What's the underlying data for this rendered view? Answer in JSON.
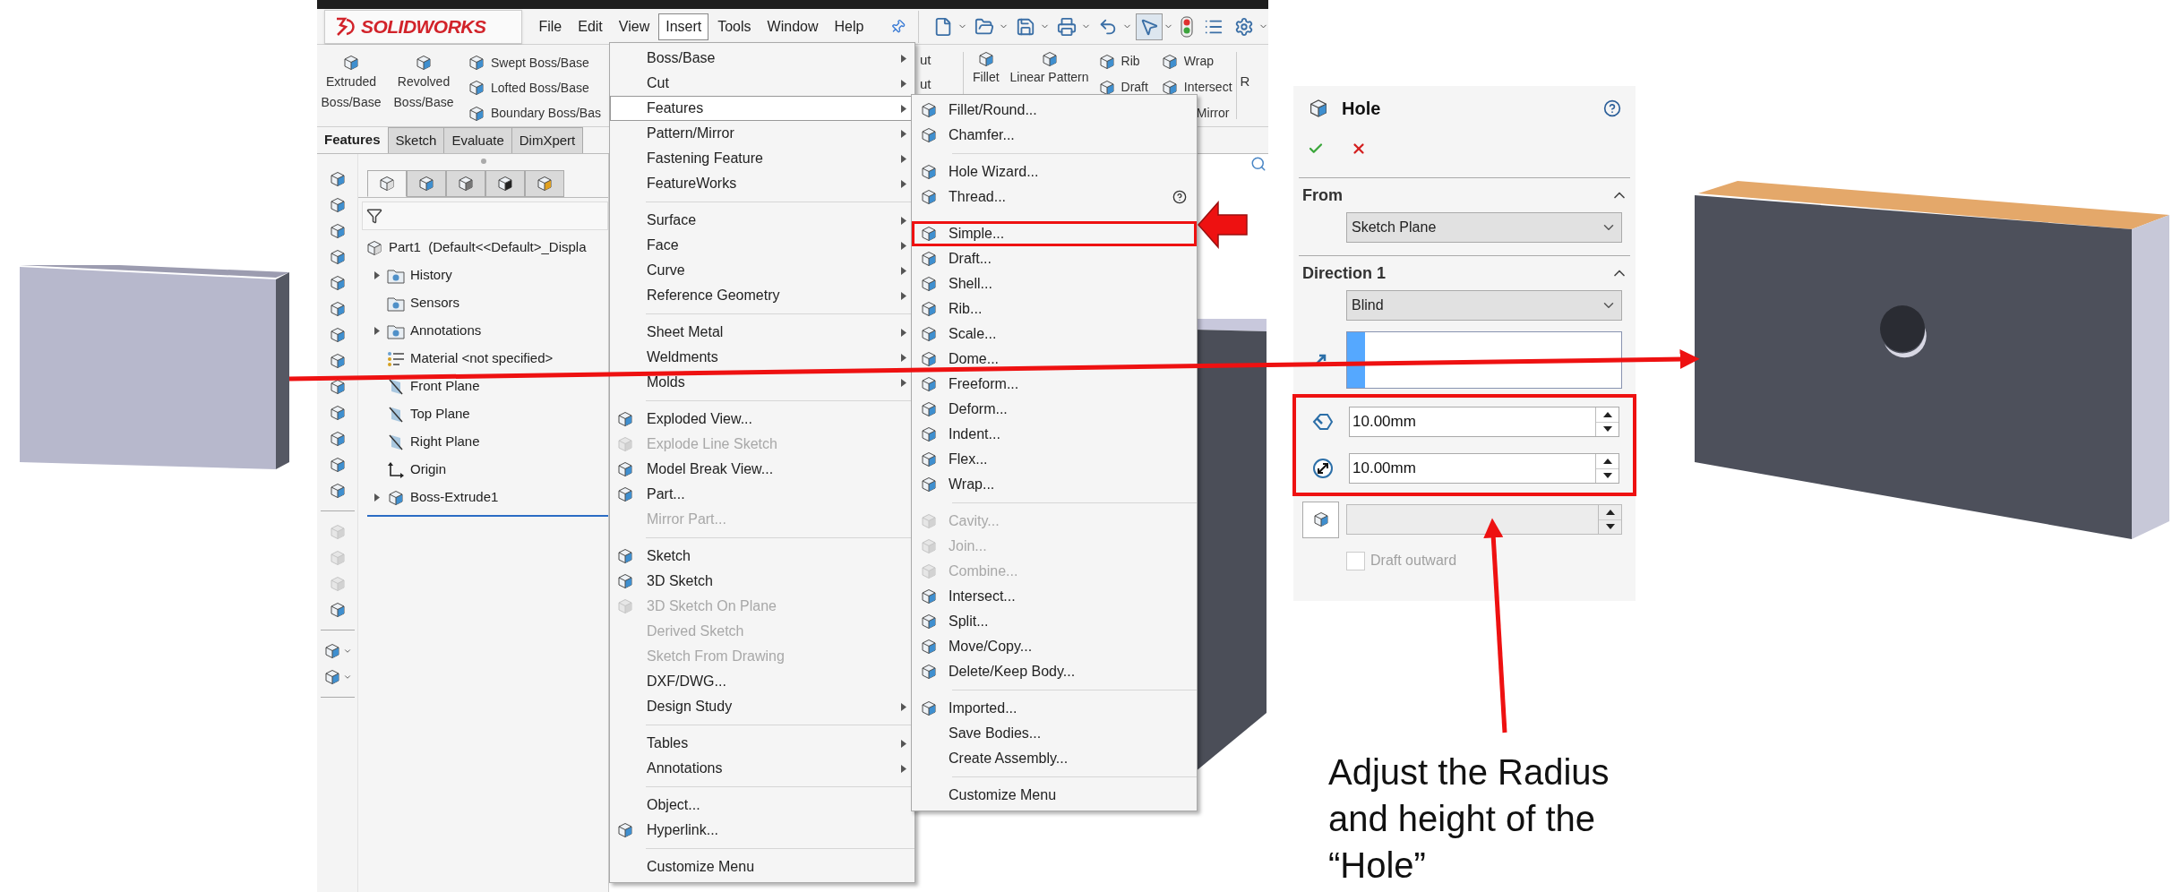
{
  "window": {
    "logo": "SOLIDWORKS",
    "menu_bar": [
      {
        "label": "File",
        "selected": false
      },
      {
        "label": "Edit",
        "selected": false
      },
      {
        "label": "View",
        "selected": false
      },
      {
        "label": "Insert",
        "selected": true
      },
      {
        "label": "Tools",
        "selected": false
      },
      {
        "label": "Window",
        "selected": false
      },
      {
        "label": "Help",
        "selected": false
      }
    ],
    "quick_access": [
      {
        "selected": false
      },
      {
        "selected": false
      },
      {
        "selected": false
      },
      {
        "selected": false
      },
      {
        "selected": false
      },
      {
        "selected": true
      },
      {
        "selected": false
      },
      {
        "selected": false
      },
      {
        "selected": false
      }
    ],
    "ribbon": {
      "large": [
        "Extruded Boss/Base",
        "Revolved Boss/Base"
      ],
      "small": [
        "Swept Boss/Base",
        "Lofted Boss/Base",
        "Boundary Boss/Bas"
      ],
      "fragments": [
        "ut",
        "ut"
      ],
      "features_large": [
        "Fillet",
        "Linear Pattern"
      ],
      "features_small_1": [
        "Rib",
        "Draft"
      ],
      "features_small_2": [
        "Wrap",
        "Intersect",
        "Mirror"
      ],
      "cut_label": "R"
    },
    "tabs": [
      {
        "label": "Features",
        "selected": true
      },
      {
        "label": "Sketch",
        "selected": false
      },
      {
        "label": "Evaluate",
        "selected": false
      },
      {
        "label": "DimXpert",
        "selected": false
      }
    ],
    "command_tools": [
      [
        {
          "kind": "button",
          "disabled": false
        },
        {
          "kind": "button",
          "disabled": false
        },
        {
          "kind": "button",
          "disabled": false
        },
        {
          "kind": "button",
          "disabled": false
        },
        {
          "kind": "button",
          "disabled": false
        },
        {
          "kind": "button",
          "disabled": false
        },
        {
          "kind": "button",
          "disabled": false
        },
        {
          "kind": "button",
          "disabled": false
        },
        {
          "kind": "button",
          "disabled": false
        },
        {
          "kind": "button",
          "disabled": false
        },
        {
          "kind": "button",
          "disabled": false
        },
        {
          "kind": "button",
          "disabled": false
        },
        {
          "kind": "button",
          "disabled": false
        }
      ],
      [
        {
          "kind": "button",
          "disabled": true
        },
        {
          "kind": "button",
          "disabled": true
        },
        {
          "kind": "button",
          "disabled": true
        },
        {
          "kind": "button",
          "disabled": false
        }
      ],
      [
        {
          "kind": "dropdown",
          "disabled": false
        },
        {
          "kind": "dropdown",
          "disabled": false
        }
      ]
    ],
    "panel_tabs": [
      {
        "selected": true
      },
      {
        "selected": false
      },
      {
        "selected": false
      },
      {
        "selected": false
      },
      {
        "selected": false
      }
    ],
    "tree": {
      "label": "Part1  (Default<<Default>_Displa",
      "children": [
        {
          "label": "History",
          "kind": "folder",
          "collapsible": true
        },
        {
          "label": "Sensors",
          "kind": "folder",
          "collapsible": false
        },
        {
          "label": "Annotations",
          "kind": "folder",
          "collapsible": true
        },
        {
          "label": "Material <not specified>",
          "kind": "material",
          "collapsible": false
        },
        {
          "label": "Front Plane",
          "kind": "plane",
          "collapsible": false
        },
        {
          "label": "Top Plane",
          "kind": "plane",
          "collapsible": false
        },
        {
          "label": "Right Plane",
          "kind": "plane",
          "collapsible": false
        },
        {
          "label": "Origin",
          "kind": "origin",
          "collapsible": false
        },
        {
          "label": "Boss-Extrude1",
          "kind": "body",
          "collapsible": true
        }
      ]
    }
  },
  "insert_menu": {
    "groups": [
      [
        {
          "label": "Boss/Base",
          "kind": "submenu",
          "selected": false,
          "disabled": false
        },
        {
          "label": "Cut",
          "kind": "submenu",
          "selected": false,
          "disabled": false
        },
        {
          "label": "Features",
          "kind": "submenu",
          "selected": true,
          "disabled": false
        },
        {
          "label": "Pattern/Mirror",
          "kind": "submenu",
          "selected": false,
          "disabled": false
        },
        {
          "label": "Fastening Feature",
          "kind": "submenu",
          "selected": false,
          "disabled": false
        },
        {
          "label": "FeatureWorks",
          "kind": "submenu",
          "selected": false,
          "disabled": false
        }
      ],
      [
        {
          "label": "Surface",
          "kind": "submenu",
          "selected": false,
          "disabled": false
        },
        {
          "label": "Face",
          "kind": "submenu",
          "selected": false,
          "disabled": false
        },
        {
          "label": "Curve",
          "kind": "submenu",
          "selected": false,
          "disabled": false
        },
        {
          "label": "Reference Geometry",
          "kind": "submenu",
          "selected": false,
          "disabled": false
        }
      ],
      [
        {
          "label": "Sheet Metal",
          "kind": "submenu",
          "selected": false,
          "disabled": false
        },
        {
          "label": "Weldments",
          "kind": "submenu",
          "selected": false,
          "disabled": false
        },
        {
          "label": "Molds",
          "kind": "submenu",
          "selected": false,
          "disabled": false
        }
      ],
      [
        {
          "label": "Exploded View...",
          "kind": "icon",
          "selected": false,
          "disabled": false
        },
        {
          "label": "Explode Line Sketch",
          "kind": "icon",
          "selected": false,
          "disabled": true
        },
        {
          "label": "Model Break View...",
          "kind": "icon",
          "selected": false,
          "disabled": false
        },
        {
          "label": "Part...",
          "kind": "icon",
          "selected": false,
          "disabled": false
        },
        {
          "label": "Mirror Part...",
          "kind": "plain",
          "selected": false,
          "disabled": true
        }
      ],
      [
        {
          "label": "Sketch",
          "kind": "icon",
          "selected": false,
          "disabled": false
        },
        {
          "label": "3D Sketch",
          "kind": "icon",
          "selected": false,
          "disabled": false
        },
        {
          "label": "3D Sketch On Plane",
          "kind": "icon",
          "selected": false,
          "disabled": true
        },
        {
          "label": "Derived Sketch",
          "kind": "plain",
          "selected": false,
          "disabled": true
        },
        {
          "label": "Sketch From Drawing",
          "kind": "plain",
          "selected": false,
          "disabled": true
        },
        {
          "label": "DXF/DWG...",
          "kind": "plain",
          "selected": false,
          "disabled": false
        },
        {
          "label": "Design Study",
          "kind": "submenu",
          "selected": false,
          "disabled": false
        }
      ],
      [
        {
          "label": "Tables",
          "kind": "submenu",
          "selected": false,
          "disabled": false
        },
        {
          "label": "Annotations",
          "kind": "submenu",
          "selected": false,
          "disabled": false
        }
      ],
      [
        {
          "label": "Object...",
          "kind": "plain",
          "selected": false,
          "disabled": false
        },
        {
          "label": "Hyperlink...",
          "kind": "icon",
          "selected": false,
          "disabled": false
        }
      ],
      [
        {
          "label": "Customize Menu",
          "kind": "plain",
          "selected": false,
          "disabled": false
        }
      ]
    ]
  },
  "features_menu": {
    "groups": [
      [
        {
          "label": "Fillet/Round...",
          "kind": "icon",
          "disabled": false,
          "annotated": false
        },
        {
          "label": "Chamfer...",
          "kind": "icon",
          "disabled": false,
          "annotated": false
        }
      ],
      [
        {
          "label": "Hole Wizard...",
          "kind": "icon",
          "disabled": false,
          "annotated": false
        },
        {
          "label": "Thread...",
          "kind": "icon_help",
          "disabled": false,
          "annotated": false
        }
      ],
      [
        {
          "label": "Simple...",
          "kind": "icon",
          "disabled": false,
          "annotated": true
        },
        {
          "label": "Draft...",
          "kind": "icon",
          "disabled": false,
          "annotated": false
        },
        {
          "label": "Shell...",
          "kind": "icon",
          "disabled": false,
          "annotated": false
        },
        {
          "label": "Rib...",
          "kind": "icon",
          "disabled": false,
          "annotated": false
        },
        {
          "label": "Scale...",
          "kind": "icon",
          "disabled": false,
          "annotated": false
        },
        {
          "label": "Dome...",
          "kind": "icon",
          "disabled": false,
          "annotated": false
        },
        {
          "label": "Freeform...",
          "kind": "icon",
          "disabled": false,
          "annotated": false
        },
        {
          "label": "Deform...",
          "kind": "icon",
          "disabled": false,
          "annotated": false
        },
        {
          "label": "Indent...",
          "kind": "icon",
          "disabled": false,
          "annotated": false
        },
        {
          "label": "Flex...",
          "kind": "icon",
          "disabled": false,
          "annotated": false
        },
        {
          "label": "Wrap...",
          "kind": "icon",
          "disabled": false,
          "annotated": false
        }
      ],
      [
        {
          "label": "Cavity...",
          "kind": "icon",
          "disabled": true,
          "annotated": false
        },
        {
          "label": "Join...",
          "kind": "icon",
          "disabled": true,
          "annotated": false
        },
        {
          "label": "Combine...",
          "kind": "icon",
          "disabled": true,
          "annotated": false
        },
        {
          "label": "Intersect...",
          "kind": "icon",
          "disabled": false,
          "annotated": false
        },
        {
          "label": "Split...",
          "kind": "icon",
          "disabled": false,
          "annotated": false
        },
        {
          "label": "Move/Copy...",
          "kind": "icon",
          "disabled": false,
          "annotated": false
        },
        {
          "label": "Delete/Keep Body...",
          "kind": "icon",
          "disabled": false,
          "annotated": false
        }
      ],
      [
        {
          "label": "Imported...",
          "kind": "icon",
          "disabled": false,
          "annotated": false
        },
        {
          "label": "Save Bodies...",
          "kind": "plain",
          "disabled": false,
          "annotated": false
        },
        {
          "label": "Create Assembly...",
          "kind": "plain",
          "disabled": false,
          "annotated": false
        }
      ],
      [
        {
          "label": "Customize Menu",
          "kind": "plain",
          "disabled": false,
          "annotated": false
        }
      ]
    ]
  },
  "hole_panel": {
    "title": "Hole",
    "from": {
      "title": "From",
      "expanded": true,
      "dropdown": "Sketch Plane"
    },
    "direction": {
      "title": "Direction 1",
      "expanded": true,
      "dropdown": "Blind",
      "annotated": true,
      "depth": "10.00mm",
      "diameter": "10.00mm",
      "draft_angle_disabled": true,
      "draft_outward": {
        "label": "Draft outward",
        "checked": false,
        "disabled": true
      }
    }
  },
  "caption": "Adjust the Radius and height of the “Hole”"
}
